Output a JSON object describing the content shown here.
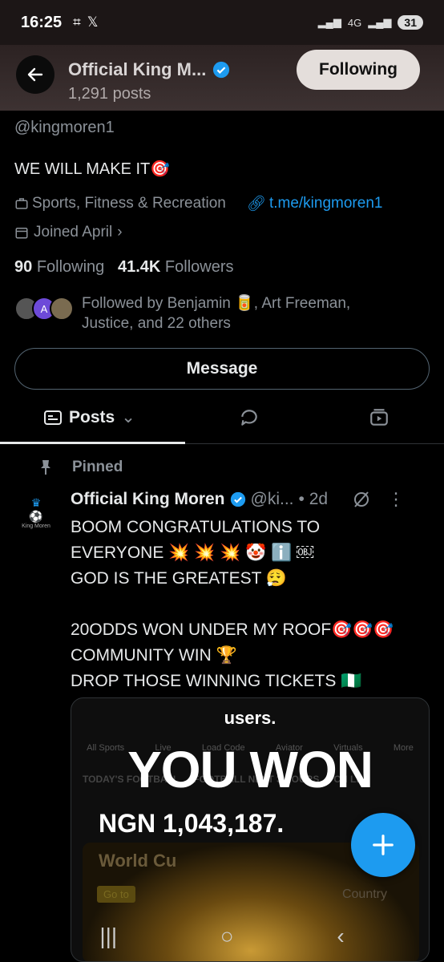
{
  "status": {
    "time": "16:25",
    "network": "4G",
    "battery": "31"
  },
  "header": {
    "title": "Official King M...",
    "posts_count": "1,291 posts",
    "following_label": "Following"
  },
  "profile": {
    "handle": "@kingmoren1",
    "bio": "WE WILL MAKE IT🎯",
    "category": "Sports, Fitness & Recreation",
    "link": "t.me/kingmoren1",
    "joined": "Joined April",
    "following_count": "90",
    "following_label": "Following",
    "followers_count": "41.4K",
    "followers_label": "Followers",
    "followed_by": "Followed by Benjamin 🥫, Art Freeman, Justice, and 22 others",
    "avatar_letter": "A",
    "message_label": "Message"
  },
  "tabs": {
    "posts_label": "Posts"
  },
  "post": {
    "pinned_label": "Pinned",
    "author_name": "Official King Moren",
    "author_handle": "@ki...",
    "time": "• 2d",
    "avatar_text": "King Moren",
    "body": "BOOM CONGRATULATIONS TO\nEVERYONE 💥 💥 💥 🤡 ℹ️ ￼\nGOD IS THE GREATEST 😮‍💨\n\n20ODDS WON UNDER MY ROOF🎯🎯🎯\nCOMMUNITY WIN 🏆\nDROP THOSE WINNING TICKETS 🇳🇬"
  },
  "media": {
    "users_text": "users.",
    "nav_items": [
      "All Sports",
      "Live",
      "Load Code",
      "Aviator",
      "Virtuals",
      "More"
    ],
    "row_items": [
      "TODAY'S FOOTBALL",
      "FOOTBALL NEXT 3 HOURS",
      "CH LE"
    ],
    "you_won": "YOU WON",
    "amount": "NGN 1,043,187.",
    "card_title": "World Cu",
    "goto": "Go to",
    "country": "Country"
  },
  "colors": {
    "accent": "#1d9bf0",
    "text": "#e7e9ea",
    "muted": "#8b9198",
    "background": "#000000"
  }
}
